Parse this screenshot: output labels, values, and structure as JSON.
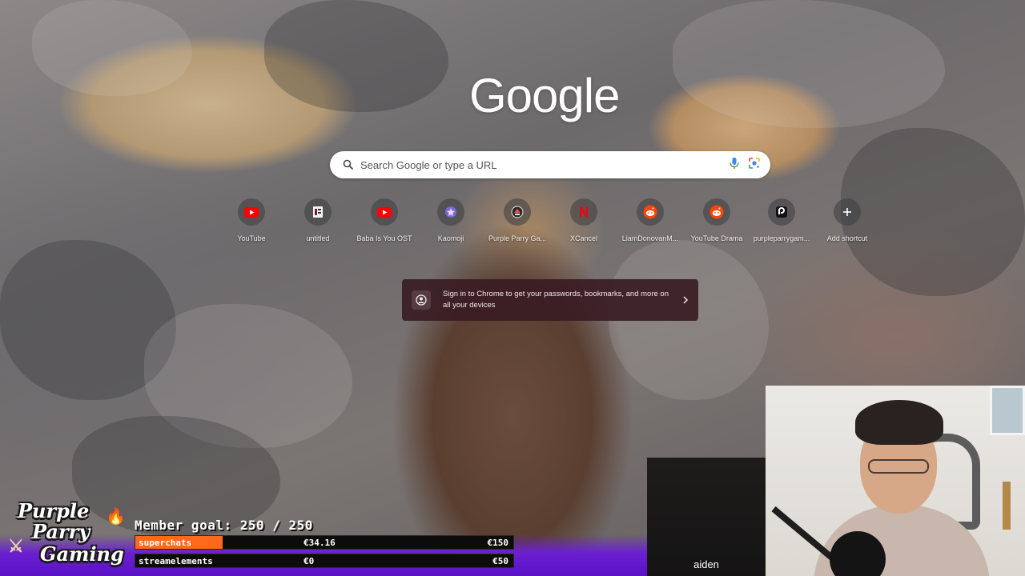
{
  "logo": {
    "text": "Google"
  },
  "search": {
    "placeholder": "Search Google or type a URL"
  },
  "shortcuts": [
    {
      "label": "YouTube",
      "icon": "youtube-icon"
    },
    {
      "label": "untitled",
      "icon": "doc-icon"
    },
    {
      "label": "Baba Is You OST",
      "icon": "youtube-icon"
    },
    {
      "label": "Kaomoji",
      "icon": "kaomoji-icon"
    },
    {
      "label": "Purple Parry Ga...",
      "icon": "purple-parry-icon"
    },
    {
      "label": "XCancel",
      "icon": "n-icon"
    },
    {
      "label": "LiamDonovanM...",
      "icon": "reddit-icon"
    },
    {
      "label": "YouTube Drama",
      "icon": "reddit-icon"
    },
    {
      "label": "purpleparrygam...",
      "icon": "app-icon"
    },
    {
      "label": "Add shortcut",
      "icon": "plus-icon"
    }
  ],
  "signin": {
    "text": "Sign in to Chrome to get your passwords, bookmarks, and more on all your devices"
  },
  "overlay": {
    "logo_lines": [
      "Purple",
      "Parry",
      "Gaming"
    ],
    "goal_title": "Member goal: 250 / 250",
    "rows": [
      {
        "name": "superchats",
        "current": "€34.16",
        "max": "€150",
        "progress": 0.23
      },
      {
        "name": "streamelements",
        "current": "€0",
        "max": "€50",
        "progress": 0.0
      }
    ],
    "chat_user": "aiden"
  },
  "colors": {
    "accent_orange": "#ff6a1a",
    "overlay_purple": "#6a1fd0",
    "signin_bg": "#3a1c24"
  }
}
